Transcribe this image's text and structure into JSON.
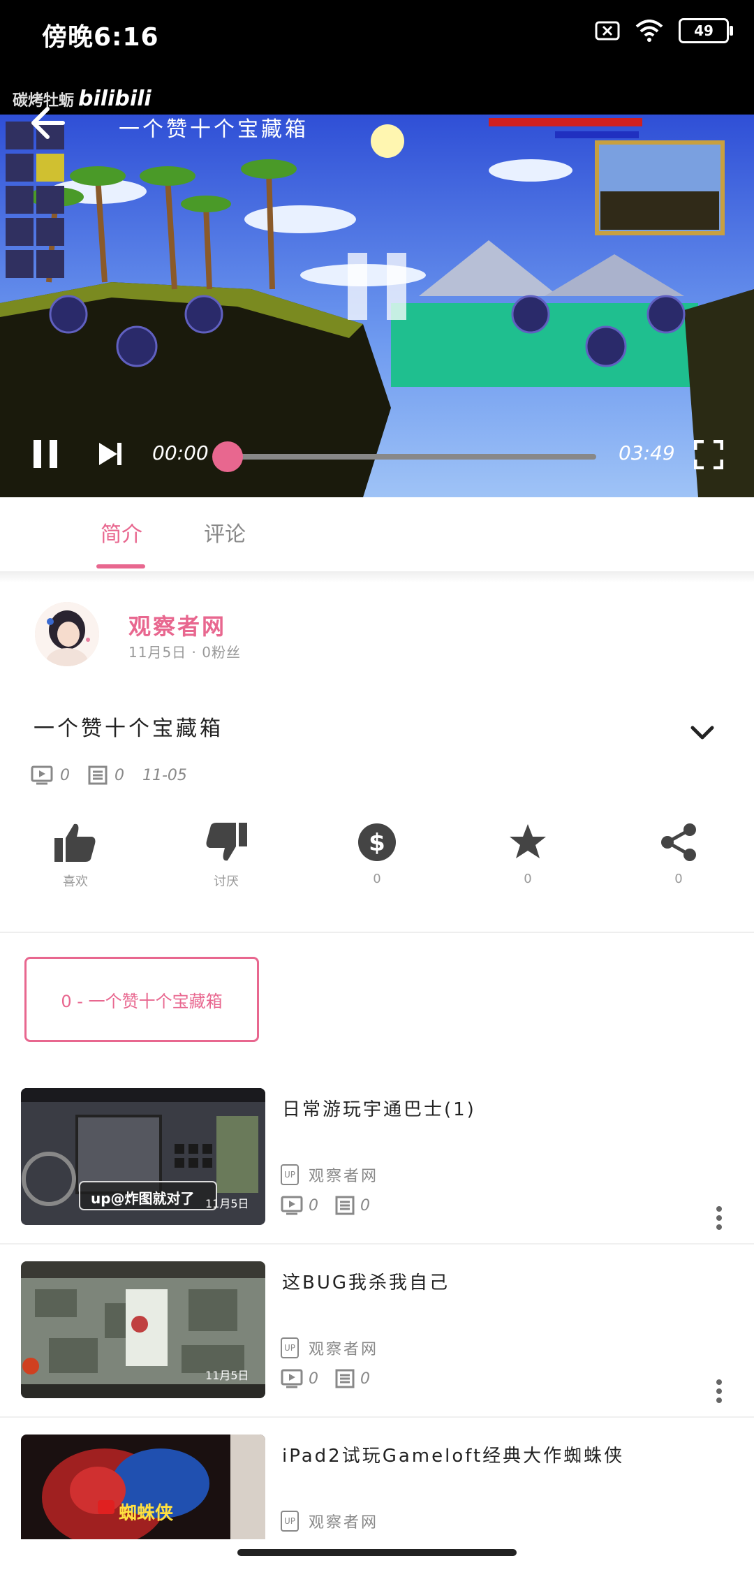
{
  "status_bar": {
    "time": "傍晚6:16",
    "battery": "49",
    "icons": [
      "sim-x-icon",
      "wifi-icon",
      "battery-icon"
    ]
  },
  "player": {
    "watermark_text": "碳烤牡蛎",
    "watermark_brand": "bilibili",
    "overlay_title": "一个赞十个宝藏箱",
    "current_time": "00:00",
    "total_time": "03:49",
    "progress_fraction": 0.0
  },
  "tabs": [
    {
      "label": "简介",
      "active": true
    },
    {
      "label": "评论",
      "active": false
    }
  ],
  "author": {
    "name": "观察者网",
    "date": "11月5日",
    "fans": "0粉丝"
  },
  "video": {
    "title": "一个赞十个宝藏箱",
    "plays": "0",
    "danmaku": "0",
    "date": "11-05"
  },
  "actions": [
    {
      "icon": "thumbs-up-icon",
      "label": "喜欢"
    },
    {
      "icon": "thumbs-down-icon",
      "label": "讨厌"
    },
    {
      "icon": "coin-icon",
      "label": "0"
    },
    {
      "icon": "star-icon",
      "label": "0"
    },
    {
      "icon": "share-icon",
      "label": "0"
    }
  ],
  "episode_button": "0 - 一个赞十个宝藏箱",
  "recommendations": [
    {
      "title": "日常游玩宇通巴士(1)",
      "up_badge": "UP",
      "uploader": "观察者网",
      "plays": "0",
      "danmaku": "0",
      "thumb_caption": "up@炸图就对了",
      "thumb_date": "11月5日"
    },
    {
      "title": "这BUG我杀我自己",
      "up_badge": "UP",
      "uploader": "观察者网",
      "plays": "0",
      "danmaku": "0",
      "thumb_caption": "",
      "thumb_date": "11月5日"
    },
    {
      "title": "iPad2试玩Gameloft经典大作蜘蛛侠",
      "up_badge": "UP",
      "uploader": "观察者网",
      "plays": "",
      "danmaku": "",
      "thumb_caption": "蜘蛛侠",
      "thumb_date": ""
    }
  ],
  "colors": {
    "accent": "#e8678f",
    "text_muted": "#888888"
  }
}
